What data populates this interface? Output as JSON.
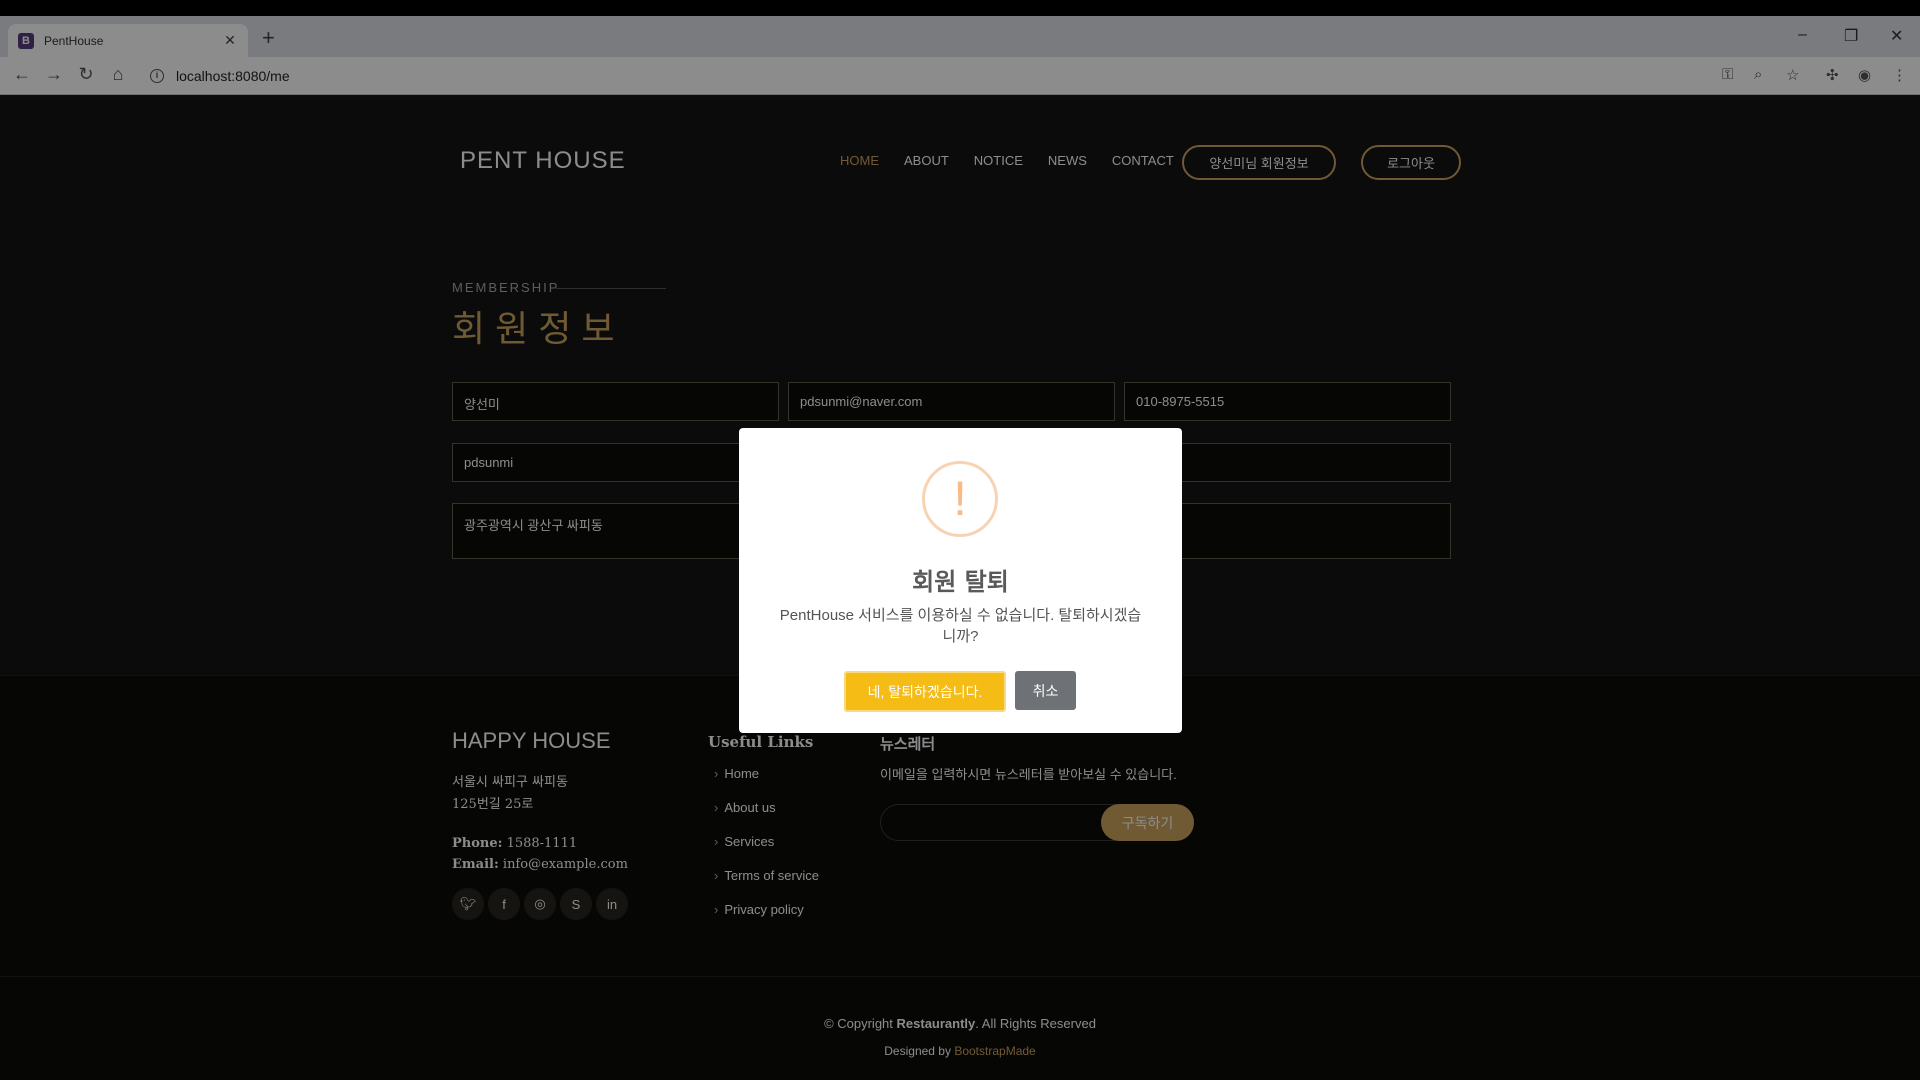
{
  "browser": {
    "tab_title": "PentHouse",
    "tab_favicon": "B",
    "url": "localhost:8080/me",
    "icons": [
      "back-icon",
      "forward-icon",
      "reload-icon",
      "home-icon",
      "info-icon",
      "key-icon",
      "zoom-icon",
      "star-icon",
      "extensions-icon",
      "profile-icon",
      "menu-icon"
    ]
  },
  "header": {
    "logo": "PENT HOUSE",
    "nav": [
      "HOME",
      "ABOUT",
      "NOTICE",
      "NEWS",
      "CONTACT"
    ],
    "member_button": "양선미님 회원정보",
    "logout_button": "로그아웃"
  },
  "section": {
    "subtitle": "MEMBERSHIP",
    "title": "회원정보"
  },
  "form": {
    "name": "양선미",
    "email": "pdsunmi@naver.com",
    "phone": "010-8975-5515",
    "user_id": "pdsunmi",
    "address": "광주광역시 광산구 싸피동"
  },
  "footer": {
    "title": "HAPPY HOUSE",
    "address_line1": "서울시 싸피구 싸피동",
    "address_line2": "125번길 25로",
    "phone_label": "Phone:",
    "phone": "1588-1111",
    "email_label": "Email:",
    "email": "info@example.com",
    "social": [
      "twitter-icon",
      "facebook-icon",
      "instagram-icon",
      "skype-icon",
      "linkedin-icon"
    ],
    "links_title": "Useful Links",
    "links": [
      "Home",
      "About us",
      "Services",
      "Terms of service",
      "Privacy policy"
    ],
    "newsletter_title": "뉴스레터",
    "newsletter_desc": "이메일을 입력하시면 뉴스레터를 받아보실 수 있습니다.",
    "subscribe_button": "구독하기",
    "copyright_prefix": "© Copyright",
    "copyright_brand": "Restaurantly",
    "copyright_suffix": ". All Rights Reserved",
    "designed_by": "Designed by",
    "designer": "BootstrapMade"
  },
  "modal": {
    "icon": "!",
    "title": "회원 탈퇴",
    "text": "PentHouse 서비스를 이용하실 수 없습니다. 탈퇴하시겠습니까?",
    "confirm": "네, 탈퇴하겠습니다.",
    "cancel": "취소"
  },
  "colors": {
    "accent": "#cda45e",
    "background": "#141414",
    "confirm": "#f4bc14",
    "cancel": "#6e7175"
  }
}
